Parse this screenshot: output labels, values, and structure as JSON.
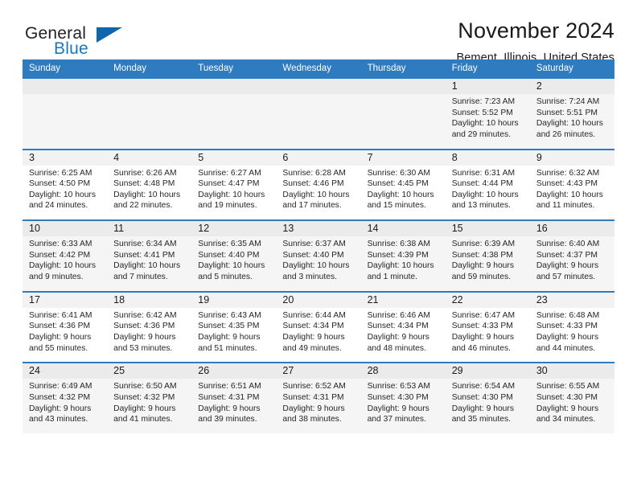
{
  "brand": {
    "name_part1": "General",
    "name_part2": "Blue"
  },
  "header": {
    "title": "November 2024",
    "subtitle": "Bement, Illinois, United States"
  },
  "colors": {
    "header_blue": "#2e7bc0",
    "logo_blue": "#1878be",
    "row_shade": "#f5f5f5",
    "day_band": "#f2f2f2"
  },
  "calendar": {
    "weekdays": [
      "Sunday",
      "Monday",
      "Tuesday",
      "Wednesday",
      "Thursday",
      "Friday",
      "Saturday"
    ],
    "weeks": [
      [
        {
          "day": "",
          "sunrise": "",
          "sunset": "",
          "daylight": ""
        },
        {
          "day": "",
          "sunrise": "",
          "sunset": "",
          "daylight": ""
        },
        {
          "day": "",
          "sunrise": "",
          "sunset": "",
          "daylight": ""
        },
        {
          "day": "",
          "sunrise": "",
          "sunset": "",
          "daylight": ""
        },
        {
          "day": "",
          "sunrise": "",
          "sunset": "",
          "daylight": ""
        },
        {
          "day": "1",
          "sunrise": "Sunrise: 7:23 AM",
          "sunset": "Sunset: 5:52 PM",
          "daylight": "Daylight: 10 hours and 29 minutes."
        },
        {
          "day": "2",
          "sunrise": "Sunrise: 7:24 AM",
          "sunset": "Sunset: 5:51 PM",
          "daylight": "Daylight: 10 hours and 26 minutes."
        }
      ],
      [
        {
          "day": "3",
          "sunrise": "Sunrise: 6:25 AM",
          "sunset": "Sunset: 4:50 PM",
          "daylight": "Daylight: 10 hours and 24 minutes."
        },
        {
          "day": "4",
          "sunrise": "Sunrise: 6:26 AM",
          "sunset": "Sunset: 4:48 PM",
          "daylight": "Daylight: 10 hours and 22 minutes."
        },
        {
          "day": "5",
          "sunrise": "Sunrise: 6:27 AM",
          "sunset": "Sunset: 4:47 PM",
          "daylight": "Daylight: 10 hours and 19 minutes."
        },
        {
          "day": "6",
          "sunrise": "Sunrise: 6:28 AM",
          "sunset": "Sunset: 4:46 PM",
          "daylight": "Daylight: 10 hours and 17 minutes."
        },
        {
          "day": "7",
          "sunrise": "Sunrise: 6:30 AM",
          "sunset": "Sunset: 4:45 PM",
          "daylight": "Daylight: 10 hours and 15 minutes."
        },
        {
          "day": "8",
          "sunrise": "Sunrise: 6:31 AM",
          "sunset": "Sunset: 4:44 PM",
          "daylight": "Daylight: 10 hours and 13 minutes."
        },
        {
          "day": "9",
          "sunrise": "Sunrise: 6:32 AM",
          "sunset": "Sunset: 4:43 PM",
          "daylight": "Daylight: 10 hours and 11 minutes."
        }
      ],
      [
        {
          "day": "10",
          "sunrise": "Sunrise: 6:33 AM",
          "sunset": "Sunset: 4:42 PM",
          "daylight": "Daylight: 10 hours and 9 minutes."
        },
        {
          "day": "11",
          "sunrise": "Sunrise: 6:34 AM",
          "sunset": "Sunset: 4:41 PM",
          "daylight": "Daylight: 10 hours and 7 minutes."
        },
        {
          "day": "12",
          "sunrise": "Sunrise: 6:35 AM",
          "sunset": "Sunset: 4:40 PM",
          "daylight": "Daylight: 10 hours and 5 minutes."
        },
        {
          "day": "13",
          "sunrise": "Sunrise: 6:37 AM",
          "sunset": "Sunset: 4:40 PM",
          "daylight": "Daylight: 10 hours and 3 minutes."
        },
        {
          "day": "14",
          "sunrise": "Sunrise: 6:38 AM",
          "sunset": "Sunset: 4:39 PM",
          "daylight": "Daylight: 10 hours and 1 minute."
        },
        {
          "day": "15",
          "sunrise": "Sunrise: 6:39 AM",
          "sunset": "Sunset: 4:38 PM",
          "daylight": "Daylight: 9 hours and 59 minutes."
        },
        {
          "day": "16",
          "sunrise": "Sunrise: 6:40 AM",
          "sunset": "Sunset: 4:37 PM",
          "daylight": "Daylight: 9 hours and 57 minutes."
        }
      ],
      [
        {
          "day": "17",
          "sunrise": "Sunrise: 6:41 AM",
          "sunset": "Sunset: 4:36 PM",
          "daylight": "Daylight: 9 hours and 55 minutes."
        },
        {
          "day": "18",
          "sunrise": "Sunrise: 6:42 AM",
          "sunset": "Sunset: 4:36 PM",
          "daylight": "Daylight: 9 hours and 53 minutes."
        },
        {
          "day": "19",
          "sunrise": "Sunrise: 6:43 AM",
          "sunset": "Sunset: 4:35 PM",
          "daylight": "Daylight: 9 hours and 51 minutes."
        },
        {
          "day": "20",
          "sunrise": "Sunrise: 6:44 AM",
          "sunset": "Sunset: 4:34 PM",
          "daylight": "Daylight: 9 hours and 49 minutes."
        },
        {
          "day": "21",
          "sunrise": "Sunrise: 6:46 AM",
          "sunset": "Sunset: 4:34 PM",
          "daylight": "Daylight: 9 hours and 48 minutes."
        },
        {
          "day": "22",
          "sunrise": "Sunrise: 6:47 AM",
          "sunset": "Sunset: 4:33 PM",
          "daylight": "Daylight: 9 hours and 46 minutes."
        },
        {
          "day": "23",
          "sunrise": "Sunrise: 6:48 AM",
          "sunset": "Sunset: 4:33 PM",
          "daylight": "Daylight: 9 hours and 44 minutes."
        }
      ],
      [
        {
          "day": "24",
          "sunrise": "Sunrise: 6:49 AM",
          "sunset": "Sunset: 4:32 PM",
          "daylight": "Daylight: 9 hours and 43 minutes."
        },
        {
          "day": "25",
          "sunrise": "Sunrise: 6:50 AM",
          "sunset": "Sunset: 4:32 PM",
          "daylight": "Daylight: 9 hours and 41 minutes."
        },
        {
          "day": "26",
          "sunrise": "Sunrise: 6:51 AM",
          "sunset": "Sunset: 4:31 PM",
          "daylight": "Daylight: 9 hours and 39 minutes."
        },
        {
          "day": "27",
          "sunrise": "Sunrise: 6:52 AM",
          "sunset": "Sunset: 4:31 PM",
          "daylight": "Daylight: 9 hours and 38 minutes."
        },
        {
          "day": "28",
          "sunrise": "Sunrise: 6:53 AM",
          "sunset": "Sunset: 4:30 PM",
          "daylight": "Daylight: 9 hours and 37 minutes."
        },
        {
          "day": "29",
          "sunrise": "Sunrise: 6:54 AM",
          "sunset": "Sunset: 4:30 PM",
          "daylight": "Daylight: 9 hours and 35 minutes."
        },
        {
          "day": "30",
          "sunrise": "Sunrise: 6:55 AM",
          "sunset": "Sunset: 4:30 PM",
          "daylight": "Daylight: 9 hours and 34 minutes."
        }
      ]
    ]
  }
}
